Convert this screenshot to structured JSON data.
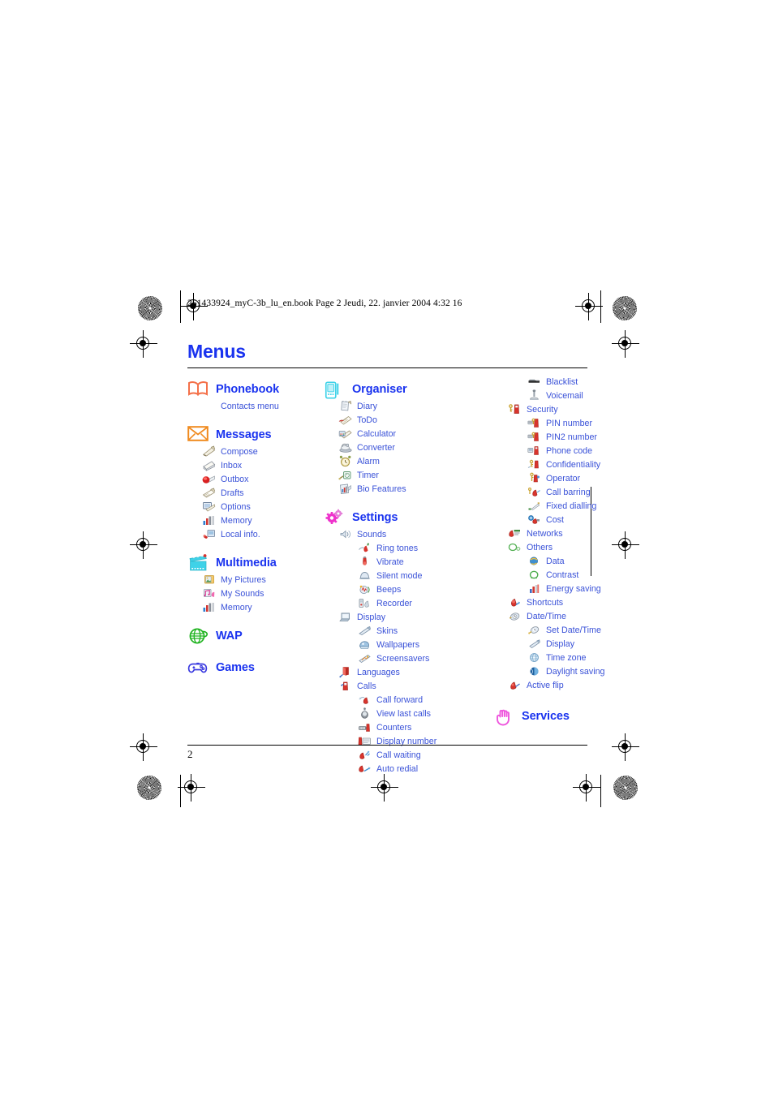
{
  "document": {
    "filestamp": "251433924_myC-3b_lu_en.book  Page 2  Jeudi, 22. janvier 2004  4:32 16",
    "title": "Menus",
    "page_number": "2"
  },
  "colors": {
    "title_blue": "#1a33ef",
    "heading_blue": "#1a33ef",
    "item_blue": "#3a52d8",
    "phonebook_icon": "#f4714a",
    "messages_icon": "#f08a1e",
    "multimedia_icon": "#3fd2e8",
    "wap_icon": "#1fb31f",
    "games_icon": "#3a3ae0",
    "organiser_icon": "#3fd2e8",
    "settings_icon": "#ee33cc",
    "services_icon": "#ee55dd",
    "rule": "#000000"
  },
  "columns": [
    {
      "id": "column-1",
      "groups": [
        {
          "label": "Phonebook",
          "icon": "open-book-icon",
          "items": [
            {
              "label": "Contacts menu",
              "icon": "none",
              "level": 1,
              "text_only": true
            }
          ]
        },
        {
          "label": "Messages",
          "icon": "envelope-icon",
          "items": [
            {
              "label": "Compose",
              "icon": "compose-icon",
              "level": 1
            },
            {
              "label": "Inbox",
              "icon": "inbox-icon",
              "level": 1
            },
            {
              "label": "Outbox",
              "icon": "outbox-icon",
              "level": 1
            },
            {
              "label": "Drafts",
              "icon": "drafts-icon",
              "level": 1
            },
            {
              "label": "Options",
              "icon": "options-icon",
              "level": 1
            },
            {
              "label": "Memory",
              "icon": "memory-icon",
              "level": 1
            },
            {
              "label": "Local info.",
              "icon": "local-info-icon",
              "level": 1
            }
          ]
        },
        {
          "label": "Multimedia",
          "icon": "clapperboard-icon",
          "items": [
            {
              "label": "My Pictures",
              "icon": "my-pictures-icon",
              "level": 1
            },
            {
              "label": "My Sounds",
              "icon": "my-sounds-icon",
              "level": 1
            },
            {
              "label": "Memory",
              "icon": "memory-icon",
              "level": 1
            }
          ]
        },
        {
          "label": "WAP",
          "icon": "globe-icon",
          "items": []
        },
        {
          "label": "Games",
          "icon": "gamepad-icon",
          "items": []
        }
      ]
    },
    {
      "id": "column-2",
      "groups": [
        {
          "label": "Organiser",
          "icon": "pda-icon",
          "items": [
            {
              "label": "Diary",
              "icon": "diary-icon",
              "level": 1
            },
            {
              "label": "ToDo",
              "icon": "todo-icon",
              "level": 1
            },
            {
              "label": "Calculator",
              "icon": "calculator-icon",
              "level": 1
            },
            {
              "label": "Converter",
              "icon": "converter-icon",
              "level": 1
            },
            {
              "label": "Alarm",
              "icon": "alarm-icon",
              "level": 1
            },
            {
              "label": "Timer",
              "icon": "timer-icon",
              "level": 1
            },
            {
              "label": "Bio Features",
              "icon": "bio-features-icon",
              "level": 1
            }
          ]
        },
        {
          "label": "Settings",
          "icon": "gears-icon",
          "items": [
            {
              "label": "Sounds",
              "icon": "sounds-icon",
              "level": 1
            },
            {
              "label": "Ring tones",
              "icon": "ring-tones-icon",
              "level": 2
            },
            {
              "label": "Vibrate",
              "icon": "vibrate-icon",
              "level": 2
            },
            {
              "label": "Silent mode",
              "icon": "silent-mode-icon",
              "level": 2
            },
            {
              "label": "Beeps",
              "icon": "beeps-icon",
              "level": 2
            },
            {
              "label": "Recorder",
              "icon": "recorder-icon",
              "level": 2
            },
            {
              "label": "Display",
              "icon": "display-icon",
              "level": 1
            },
            {
              "label": "Skins",
              "icon": "skins-icon",
              "level": 2
            },
            {
              "label": "Wallpapers",
              "icon": "wallpapers-icon",
              "level": 2
            },
            {
              "label": "Screensavers",
              "icon": "screensavers-icon",
              "level": 2
            },
            {
              "label": "Languages",
              "icon": "languages-icon",
              "level": 1
            },
            {
              "label": "Calls",
              "icon": "calls-icon",
              "level": 1
            },
            {
              "label": "Call forward",
              "icon": "call-forward-icon",
              "level": 2
            },
            {
              "label": "View last calls",
              "icon": "view-last-calls-icon",
              "level": 2
            },
            {
              "label": "Counters",
              "icon": "counters-icon",
              "level": 2
            },
            {
              "label": "Display number",
              "icon": "display-number-icon",
              "level": 2
            },
            {
              "label": "Call waiting",
              "icon": "call-waiting-icon",
              "level": 2
            },
            {
              "label": "Auto redial",
              "icon": "auto-redial-icon",
              "level": 2
            }
          ]
        }
      ]
    },
    {
      "id": "column-3",
      "groups": [
        {
          "label": "",
          "icon": "none",
          "items": [
            {
              "label": "Blacklist",
              "icon": "blacklist-icon",
              "level": 2
            },
            {
              "label": "Voicemail",
              "icon": "voicemail-icon",
              "level": 2
            },
            {
              "label": "Security",
              "icon": "security-icon",
              "level": 1
            },
            {
              "label": "PIN number",
              "icon": "pin-number-icon",
              "level": 2
            },
            {
              "label": "PIN2 number",
              "icon": "pin2-number-icon",
              "level": 2
            },
            {
              "label": "Phone code",
              "icon": "phone-code-icon",
              "level": 2
            },
            {
              "label": "Confidentiality",
              "icon": "confidentiality-icon",
              "level": 2
            },
            {
              "label": "Operator",
              "icon": "operator-icon",
              "level": 2
            },
            {
              "label": "Call barring",
              "icon": "call-barring-icon",
              "level": 2
            },
            {
              "label": "Fixed dialling",
              "icon": "fixed-dialling-icon",
              "level": 2
            },
            {
              "label": "Cost",
              "icon": "cost-icon",
              "level": 2
            },
            {
              "label": "Networks",
              "icon": "networks-icon",
              "level": 1
            },
            {
              "label": "Others",
              "icon": "others-icon",
              "level": 1
            },
            {
              "label": "Data",
              "icon": "data-icon",
              "level": 2
            },
            {
              "label": "Contrast",
              "icon": "contrast-icon",
              "level": 2
            },
            {
              "label": "Energy saving",
              "icon": "energy-saving-icon",
              "level": 2
            },
            {
              "label": "Shortcuts",
              "icon": "shortcuts-icon",
              "level": 1
            },
            {
              "label": "Date/Time",
              "icon": "date-time-icon",
              "level": 1
            },
            {
              "label": "Set Date/Time",
              "icon": "set-date-time-icon",
              "level": 2
            },
            {
              "label": "Display",
              "icon": "display-small-icon",
              "level": 2
            },
            {
              "label": "Time zone",
              "icon": "time-zone-icon",
              "level": 2
            },
            {
              "label": "Daylight saving",
              "icon": "daylight-saving-icon",
              "level": 2
            },
            {
              "label": "Active flip",
              "icon": "active-flip-icon",
              "level": 1
            }
          ]
        },
        {
          "label": "Services",
          "icon": "pointing-hand-icon",
          "items": []
        }
      ]
    }
  ]
}
